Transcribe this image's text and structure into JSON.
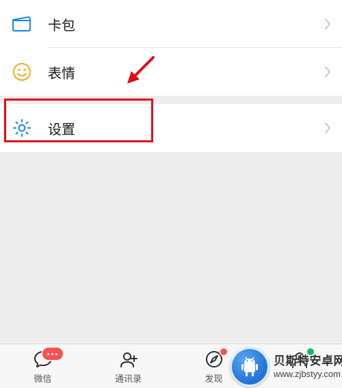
{
  "colors": {
    "wallet_icon": "#1485ee",
    "emoji_icon": "#f6a81c",
    "settings_icon": "#1485ee",
    "highlight": "#e20a17",
    "badge": "#fa5151",
    "green_dot": "#07c160"
  },
  "menu": {
    "wallet": {
      "label": "卡包"
    },
    "stickers": {
      "label": "表情"
    },
    "settings": {
      "label": "设置"
    }
  },
  "tabs": {
    "chats": {
      "label": "微信"
    },
    "contacts": {
      "label": "通讯录"
    },
    "discover": {
      "label": "发现"
    }
  },
  "watermark": {
    "line1": "贝斯特安卓网",
    "line2": "www.zjbstyy.com"
  }
}
